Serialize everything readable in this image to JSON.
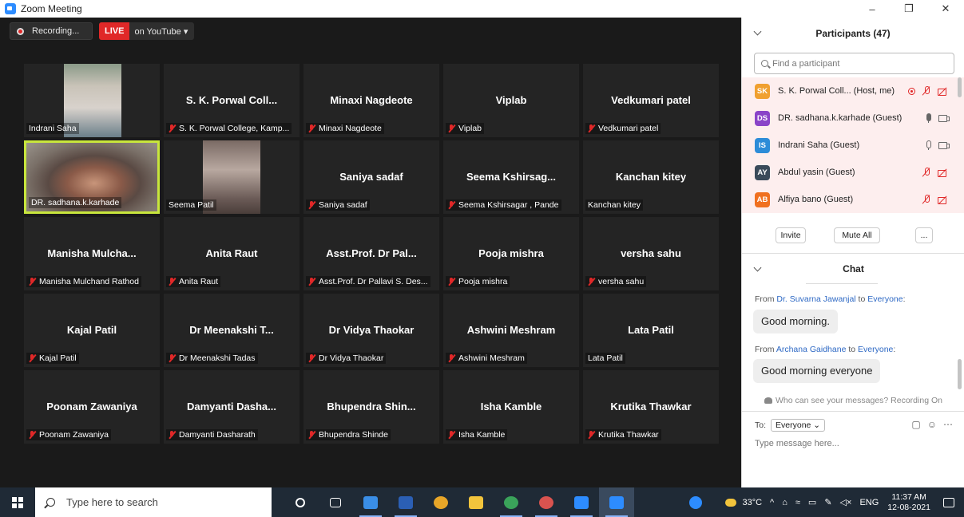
{
  "window": {
    "title": "Zoom Meeting",
    "minimize": "–",
    "maximize": "❐",
    "close": "✕"
  },
  "recording": {
    "label": "Recording...",
    "live": "LIVE",
    "live_target": "on YouTube ▾"
  },
  "tiles": [
    {
      "big": "",
      "label": "Indrani Saha",
      "muted": false,
      "photo": true
    },
    {
      "big": "S. K. Porwal Coll...",
      "label": "S. K. Porwal College, Kamp...",
      "muted": true
    },
    {
      "big": "Minaxi Nagdeote",
      "label": "Minaxi Nagdeote",
      "muted": true
    },
    {
      "big": "Viplab",
      "label": "Viplab",
      "muted": true
    },
    {
      "big": "Vedkumari  patel",
      "label": "Vedkumari  patel",
      "muted": true
    },
    {
      "big": "",
      "label": "DR. sadhana.k.karhade",
      "muted": false,
      "photo": true,
      "active": true
    },
    {
      "big": "",
      "label": "Seema Patil",
      "muted": false,
      "photo": true
    },
    {
      "big": "Saniya sadaf",
      "label": "Saniya sadaf",
      "muted": true
    },
    {
      "big": "Seema  Kshirsag...",
      "label": "Seema Kshirsagar , Pande",
      "muted": true
    },
    {
      "big": "Kanchan kitey",
      "label": "Kanchan kitey",
      "muted": false
    },
    {
      "big": "Manisha  Mulcha...",
      "label": "Manisha Mulchand Rathod",
      "muted": true
    },
    {
      "big": "Anita Raut",
      "label": "Anita Raut",
      "muted": true
    },
    {
      "big": "Asst.Prof. Dr Pal...",
      "label": "Asst.Prof. Dr Pallavi  S. Des...",
      "muted": true
    },
    {
      "big": "Pooja mishra",
      "label": "Pooja mishra",
      "muted": true
    },
    {
      "big": "versha sahu",
      "label": "versha sahu",
      "muted": true
    },
    {
      "big": "Kajal Patil",
      "label": "Kajal Patil",
      "muted": true
    },
    {
      "big": "Dr Meenakshi T...",
      "label": "Dr Meenakshi Tadas",
      "muted": true
    },
    {
      "big": "Dr Vidya Thaokar",
      "label": "Dr Vidya Thaokar",
      "muted": true
    },
    {
      "big": "Ashwini Meshram",
      "label": "Ashwini Meshram",
      "muted": true
    },
    {
      "big": "Lata Patil",
      "label": "Lata Patil",
      "muted": false
    },
    {
      "big": "Poonam Zawaniya",
      "label": "Poonam Zawaniya",
      "muted": true
    },
    {
      "big": "Damyanti  Dasha...",
      "label": "Damyanti Dasharath",
      "muted": true
    },
    {
      "big": "Bhupendra  Shin...",
      "label": "Bhupendra Shinde",
      "muted": true
    },
    {
      "big": "Isha Kamble",
      "label": "Isha Kamble",
      "muted": true
    },
    {
      "big": "Krutika Thawkar",
      "label": "Krutika Thawkar",
      "muted": true
    }
  ],
  "participants": {
    "title": "Participants (47)",
    "search_placeholder": "Find a participant",
    "list": [
      {
        "initials": "SK",
        "color": "#f0a030",
        "name": "S. K. Porwal Coll...  (Host, me)",
        "icons": "rec-mutemic-mutecam"
      },
      {
        "initials": "DS",
        "color": "#8a44c8",
        "name": "DR. sadhana.k.karhade (Guest)",
        "icons": "mic-cam"
      },
      {
        "initials": "IS",
        "color": "#2d8cd8",
        "name": "Indrani Saha (Guest)",
        "icons": "micoutline-cam"
      },
      {
        "initials": "AY",
        "color": "#3a4a5a",
        "name": "Abdul yasin (Guest)",
        "icons": "mutemic-mutecam"
      },
      {
        "initials": "AB",
        "color": "#f07020",
        "name": "Alfiya bano (Guest)",
        "icons": "mutemic-mutecam"
      }
    ],
    "invite": "Invite",
    "mute_all": "Mute All",
    "more": "..."
  },
  "chat": {
    "title": "Chat",
    "messages": [
      {
        "from_prefix": "From ",
        "from": "Dr. Suvarna Jawanjal",
        "to_word": " to ",
        "to": "Everyone",
        "colon": ":",
        "text": "Good morning."
      },
      {
        "from_prefix": "From ",
        "from": "Archana Gaidhane",
        "to_word": " to ",
        "to": "Everyone",
        "colon": ":",
        "text": "Good morning everyone"
      }
    ],
    "who_can_see": "Who can see your messages? Recording On",
    "to_label": "To:",
    "to_value": "Everyone ⌄",
    "placeholder": "Type message here..."
  },
  "taskbar": {
    "search": "Type here to search",
    "temp": "33°C",
    "lang": "ENG",
    "time": "11:37 AM",
    "date": "12-08-2021"
  }
}
